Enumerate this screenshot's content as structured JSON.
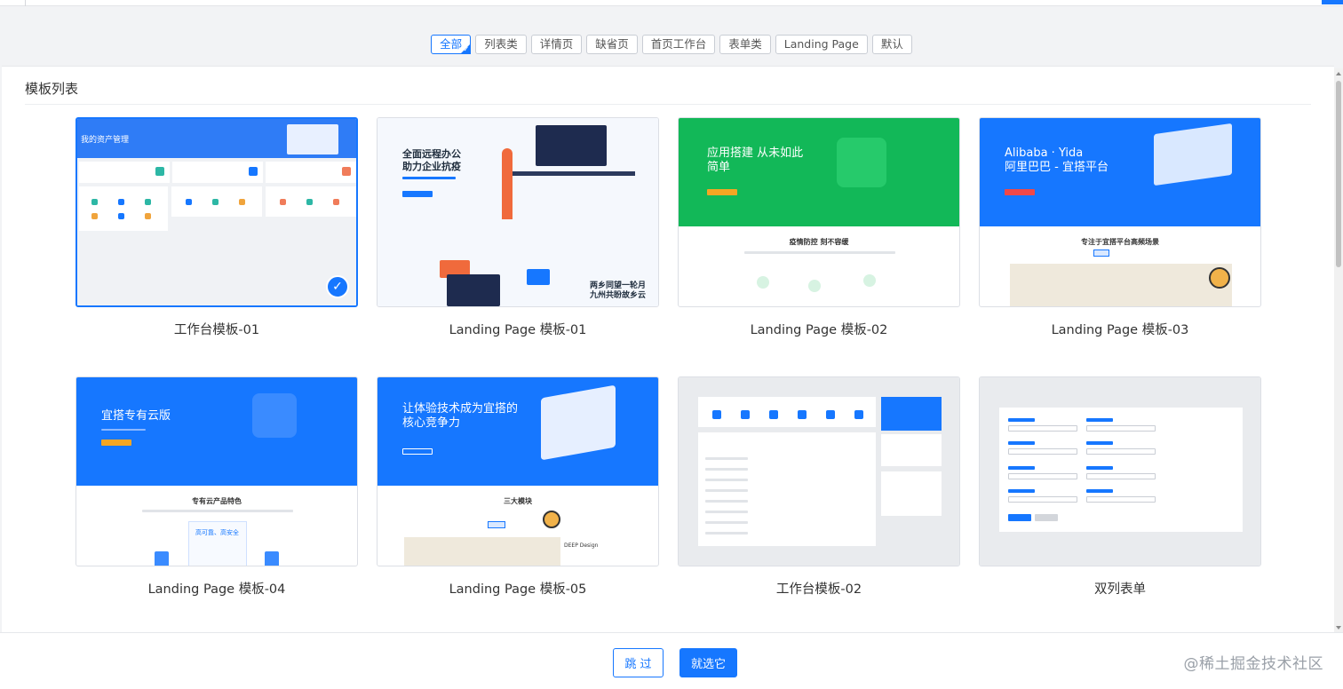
{
  "filters": [
    {
      "label": "全部",
      "active": true
    },
    {
      "label": "列表类",
      "active": false
    },
    {
      "label": "详情页",
      "active": false
    },
    {
      "label": "缺省页",
      "active": false
    },
    {
      "label": "首页工作台",
      "active": false
    },
    {
      "label": "表单类",
      "active": false
    },
    {
      "label": "Landing Page",
      "active": false
    },
    {
      "label": "默认",
      "active": false
    }
  ],
  "panel": {
    "title": "模板列表"
  },
  "templates": [
    {
      "label": "工作台模板-01",
      "selected": true,
      "hero": "我的资产管理"
    },
    {
      "label": "Landing Page 模板-01",
      "selected": false,
      "hero_line1": "全面远程办公",
      "hero_line2": "助力企业抗疫",
      "bottom_line1": "两乡同望一轮月",
      "bottom_line2": "九州共盼故乡云"
    },
    {
      "label": "Landing Page 模板-02",
      "selected": false,
      "hero_line1": "应用搭建 从未如此",
      "hero_line2": "简单",
      "section": "疫情防控 刻不容缓"
    },
    {
      "label": "Landing Page 模板-03",
      "selected": false,
      "hero_line1": "Alibaba · Yida",
      "hero_line2": "阿里巴巴 - 宜搭平台",
      "section": "专注于宜搭平台高频场景"
    },
    {
      "label": "Landing Page 模板-04",
      "selected": false,
      "hero_line1": "宜搭专有云版",
      "section": "专有云产品特色",
      "feature": "高可靠、高安全"
    },
    {
      "label": "Landing Page 模板-05",
      "selected": false,
      "hero_line1": "让体验技术成为宜搭的",
      "hero_line2": "核心竞争力",
      "section": "三大模块",
      "feature": "DEEP Design"
    },
    {
      "label": "工作台模板-02",
      "selected": false
    },
    {
      "label": "双列表单",
      "selected": false
    }
  ],
  "footer": {
    "skip_label": "跳 过",
    "select_label": "就选它",
    "watermark": "@稀土掘金技术社区"
  },
  "colors": {
    "accent": "#1677ff",
    "green": "#12b858",
    "border": "#dcdfe5"
  }
}
